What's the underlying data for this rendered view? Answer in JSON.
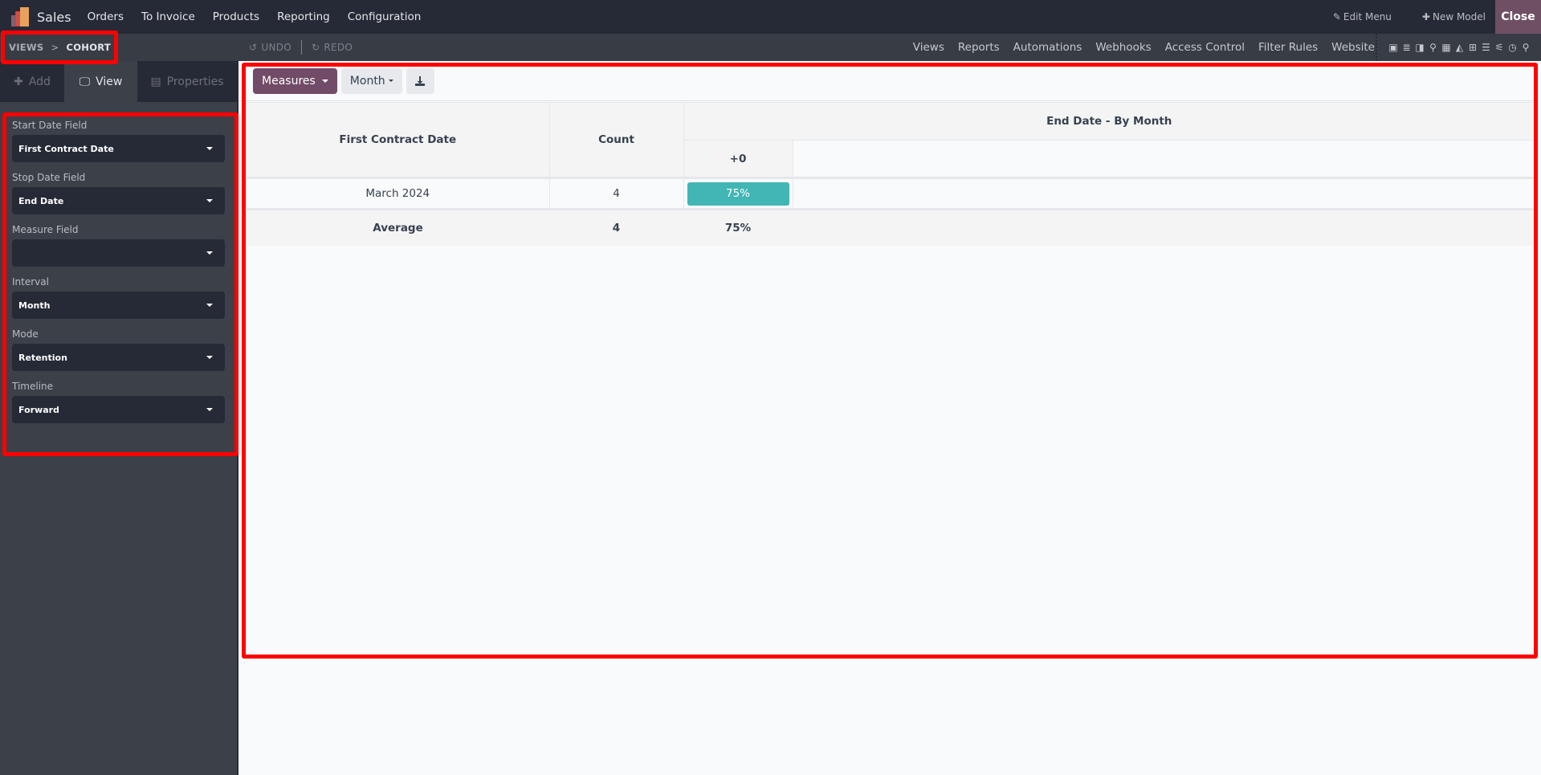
{
  "navbar": {
    "app_name": "Sales",
    "menu": [
      "Orders",
      "To Invoice",
      "Products",
      "Reporting",
      "Configuration"
    ],
    "edit_menu_label": "Edit Menu",
    "new_model_label": "New Model",
    "close_label": "Close"
  },
  "subbar": {
    "breadcrumb": {
      "parent": "VIEWS",
      "separator": ">",
      "current": "COHORT"
    },
    "undo_label": "UNDO",
    "redo_label": "REDO",
    "studio_links": [
      "Views",
      "Reports",
      "Automations",
      "Webhooks",
      "Access Control",
      "Filter Rules",
      "Website"
    ],
    "view_type_icons": [
      "form-view-icon",
      "list-view-icon",
      "kanban-view-icon",
      "map-view-icon",
      "calendar-view-icon",
      "graph-view-icon",
      "pivot-view-icon",
      "gantt-view-icon",
      "cohort-view-icon",
      "activity-view-icon",
      "search-view-icon"
    ]
  },
  "sidebar": {
    "tabs": {
      "add": "Add",
      "view": "View",
      "properties": "Properties"
    },
    "active_tab": "View",
    "fields": [
      {
        "label": "Start Date Field",
        "value": "First Contract Date"
      },
      {
        "label": "Stop Date Field",
        "value": "End Date"
      },
      {
        "label": "Measure Field",
        "value": ""
      },
      {
        "label": "Interval",
        "value": "Month"
      },
      {
        "label": "Mode",
        "value": "Retention"
      },
      {
        "label": "Timeline",
        "value": "Forward"
      }
    ]
  },
  "control_panel": {
    "measures_label": "Measures",
    "interval_label": "Month",
    "download_icon": "download-icon"
  },
  "cohort_table": {
    "row_header": "First Contract Date",
    "count_header": "Count",
    "group_header": "End Date - By Month",
    "period_headers": [
      "+0"
    ],
    "rows": [
      {
        "label": "March 2024",
        "count": "4",
        "values": [
          "75%"
        ],
        "value_fractions": [
          0.75
        ]
      }
    ],
    "footer": {
      "label": "Average",
      "count": "4",
      "values": [
        "75%"
      ]
    }
  },
  "colors": {
    "brand": "#714b67",
    "close_button": "#6e4f64",
    "retention_cell": "#41b6b4",
    "navbar_bg": "#262a36",
    "subbar_bg": "#383c45",
    "sidebar_bg": "#3c4049",
    "highlight": "#ff0000"
  }
}
